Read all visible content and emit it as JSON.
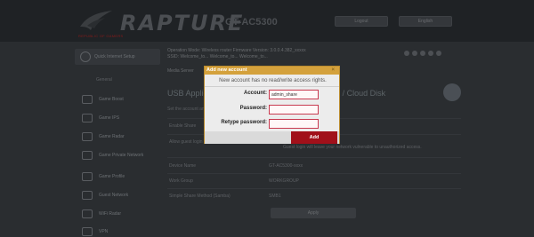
{
  "header": {
    "logo_caption": "REPUBLIC OF GAMERS",
    "brand": "RAPTURE",
    "model": "GT-AC5300",
    "logout_label": "Logout",
    "language_label": "English"
  },
  "sidebar": {
    "quick_setup": "Quick Internet Setup",
    "general_heading": "General",
    "items": [
      {
        "label": "Game Boost",
        "icon": "rocket-icon"
      },
      {
        "label": "Game IPS",
        "icon": "shield-icon"
      },
      {
        "label": "Game Radar",
        "icon": "radar-icon"
      },
      {
        "label": "Game Private Network",
        "icon": "network-icon"
      },
      {
        "label": "Game Profile",
        "icon": "controller-icon"
      },
      {
        "label": "Guest Network",
        "icon": "globe-icon"
      },
      {
        "label": "WiFi Radar",
        "icon": "wifi-icon"
      },
      {
        "label": "VPN",
        "icon": "vpn-icon"
      }
    ]
  },
  "main": {
    "status_line_1": "Operation Mode: Wireless router   Firmware Version: 3.0.0.4.382_xxxxx",
    "status_line_2": "SSID: Welcome_to...  Welcome_to...  Welcome_to...",
    "tabs_label": "Media Server",
    "page_title": "USB Application - Network Place (Samba) Share / Cloud Disk",
    "settings_desc": "Set the account and permission of network place (samba) service.",
    "rows": [
      {
        "label": "Enable Share",
        "value": ""
      },
      {
        "label": "Allow guest login",
        "value": ""
      },
      {
        "label": "Device Name",
        "value": "GT-AC5300-xxxx"
      },
      {
        "label": "Work Group",
        "value": "WORKGROUP"
      },
      {
        "label": "Simple Share Method (Samba)",
        "value": "SMB1"
      }
    ],
    "note": "Guest login will leave your network vulnerable to unauthorized access.",
    "apply_label": "Apply"
  },
  "modal": {
    "title": "Add new account",
    "close": "×",
    "message": "New account has no read/write access rights.",
    "account_label": "Account:",
    "account_value": "admin_share",
    "password_label": "Password:",
    "retype_label": "Retype password:",
    "add_label": "Add"
  },
  "colors": {
    "modal_header": "#d4a13c",
    "add_button": "#a1101a",
    "input_border": "#c83a50"
  }
}
